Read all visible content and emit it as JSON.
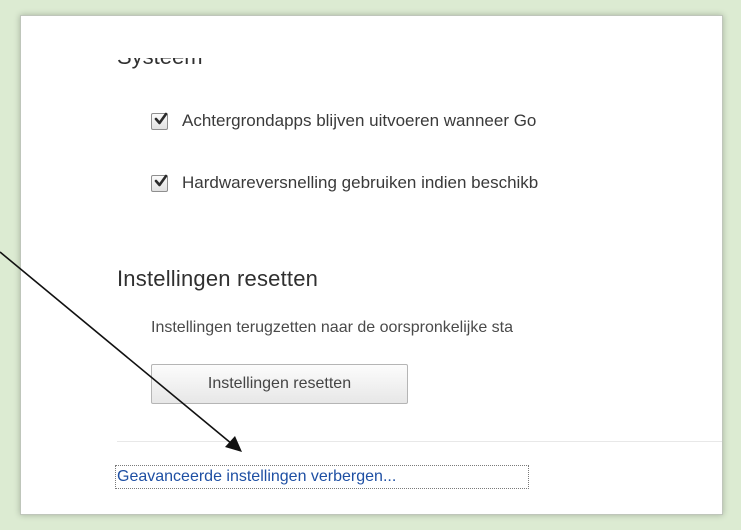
{
  "settings": {
    "system_heading": "Systeem",
    "background_apps_label": "Achtergrondapps blijven uitvoeren wanneer Go",
    "hardware_accel_label": "Hardwareversnelling gebruiken indien beschikb",
    "reset_heading": "Instellingen resetten",
    "reset_description": "Instellingen terugzetten naar de oorspronkelijke sta",
    "reset_button_label": "Instellingen resetten",
    "hide_advanced_link": "Geavanceerde instellingen verbergen..."
  },
  "checks": {
    "background_apps_checked": true,
    "hardware_accel_checked": true
  },
  "colors": {
    "background": "#dcebd2",
    "link": "#1e4fa3"
  }
}
